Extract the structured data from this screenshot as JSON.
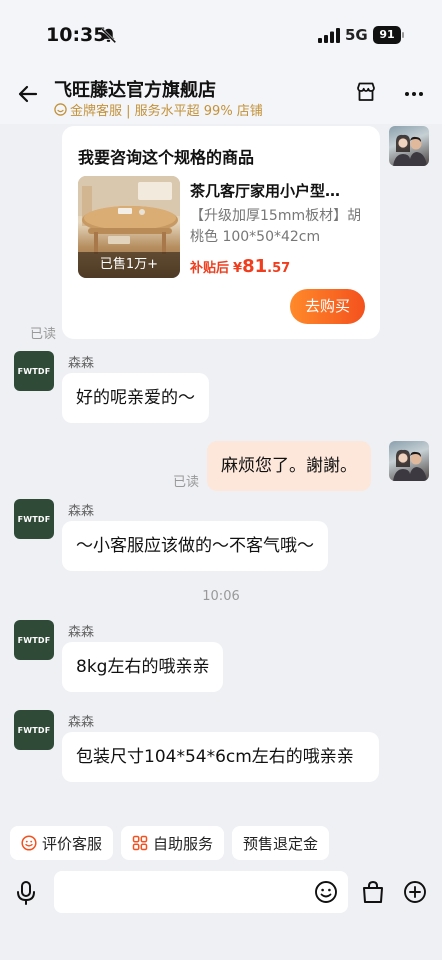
{
  "status": {
    "time": "10:35",
    "network": "5G",
    "battery": "91"
  },
  "header": {
    "shop_name": "飞旺藤达官方旗舰店",
    "subtitle": "金牌客服 | 服务水平超 99% 店铺"
  },
  "product_card": {
    "title": "我要咨询这个规格的商品",
    "sold": "已售1万+",
    "name": "茶几客厅家用小户型…",
    "spec": "【升级加厚15mm板材】胡桃色 100*50*42cm",
    "price_label": "补贴后",
    "price_currency": "¥",
    "price_int": "81",
    "price_dec": ".57",
    "buy_label": "去购买"
  },
  "messages": {
    "read_1": "已读",
    "sender_1": "森森",
    "msg_1": "好的呢亲爱的～",
    "msg_2": "麻烦您了。謝謝。",
    "read_2": "已读",
    "sender_2": "森森",
    "msg_3": "～小客服应该做的～不客气哦～",
    "time_sep": "10:06",
    "sender_3": "森森",
    "msg_4": "8kg左右的哦亲亲",
    "sender_4": "森森",
    "msg_5": "包装尺寸104*54*6cm左右的哦亲亲"
  },
  "shop_avatar_text": "FWTDF",
  "quick_actions": {
    "rate": "评价客服",
    "self_service": "自助服务",
    "deposit_refund": "预售退定金"
  },
  "input": {
    "placeholder": ""
  },
  "colors": {
    "accent": "#f4511e",
    "self_bubble": "#fde7da",
    "gold": "#c3923a"
  }
}
